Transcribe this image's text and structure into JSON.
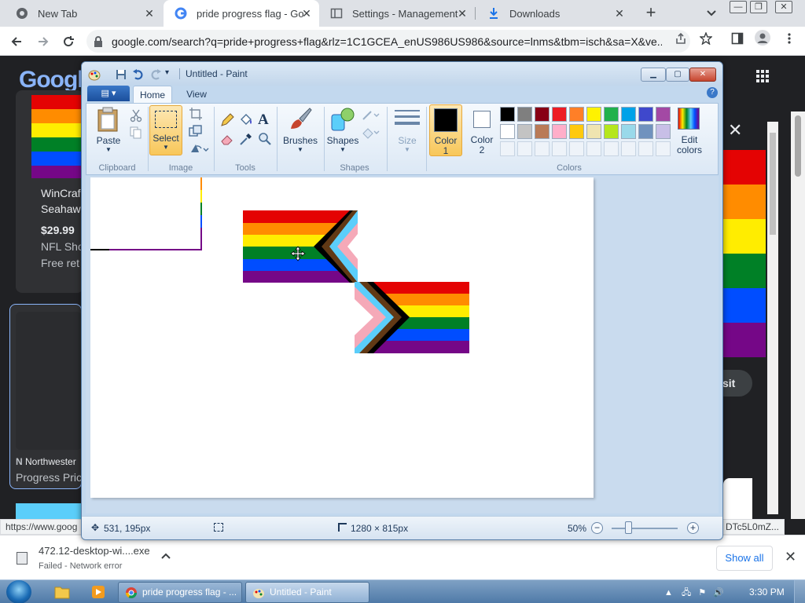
{
  "browser": {
    "tabs": [
      {
        "label": "New Tab"
      },
      {
        "label": "pride progress flag - Goo"
      },
      {
        "label": "Settings - Management"
      },
      {
        "label": "Downloads"
      }
    ],
    "url": "google.com/search?q=pride+progress+flag&rlz=1C1GCEA_enUS986US986&source=lnms&tbm=isch&sa=X&ve...",
    "status_url_left": "https://www.goog",
    "status_url_right": "DTc5L0mZ..."
  },
  "google_page": {
    "logo": "Google",
    "card1": {
      "title_line1": "WinCraf",
      "title_line2": "Seahaw",
      "price": "$29.99",
      "line3": "NFL Sho",
      "line4": "Free ret"
    },
    "card2": {
      "source": "Northwester",
      "title": "Progress Pric"
    },
    "visit_label": "sit",
    "close_icon": "close-icon"
  },
  "paint": {
    "title": "Untitled - Paint",
    "tabs": {
      "home": "Home",
      "view": "View"
    },
    "groups": {
      "clipboard": "Clipboard",
      "image": "Image",
      "tools": "Tools",
      "shapes": "Shapes",
      "colors": "Colors"
    },
    "buttons": {
      "paste": "Paste",
      "select": "Select",
      "brushes": "Brushes",
      "shapes": "Shapes",
      "size": "Size",
      "color1_line1": "Color",
      "color1_line2": "1",
      "color2_line1": "Color",
      "color2_line2": "2",
      "edit_colors_line1": "Edit",
      "edit_colors_line2": "colors"
    },
    "palette_row1": [
      "#000000",
      "#7f7f7f",
      "#880015",
      "#ed1c24",
      "#ff7f27",
      "#fff200",
      "#22b14c",
      "#00a2e8",
      "#3f48cc",
      "#a349a4"
    ],
    "palette_row2": [
      "#ffffff",
      "#c3c3c3",
      "#b97a57",
      "#ffaec9",
      "#ffc90e",
      "#efe4b0",
      "#b5e61d",
      "#99d9ea",
      "#7092be",
      "#c8bfe7"
    ],
    "color1": "#000000",
    "color2": "#ffffff",
    "status": {
      "cursor_pos": "531, 195px",
      "image_size": "1280 × 815px",
      "zoom": "50%"
    }
  },
  "downloads": {
    "file_name": "472.12-desktop-wi....exe",
    "file_status": "Failed - Network error",
    "show_all": "Show all"
  },
  "taskbar": {
    "items": [
      {
        "label": "pride progress flag - ..."
      },
      {
        "label": "Untitled - Paint"
      }
    ],
    "clock": "3:30 PM"
  },
  "flag_colors": {
    "rainbow": [
      "#e40303",
      "#ff8c00",
      "#ffed00",
      "#008026",
      "#004dff",
      "#750787"
    ],
    "chevron": [
      "#f5a9b8",
      "#5bcefa",
      "#613915",
      "#000000"
    ]
  }
}
